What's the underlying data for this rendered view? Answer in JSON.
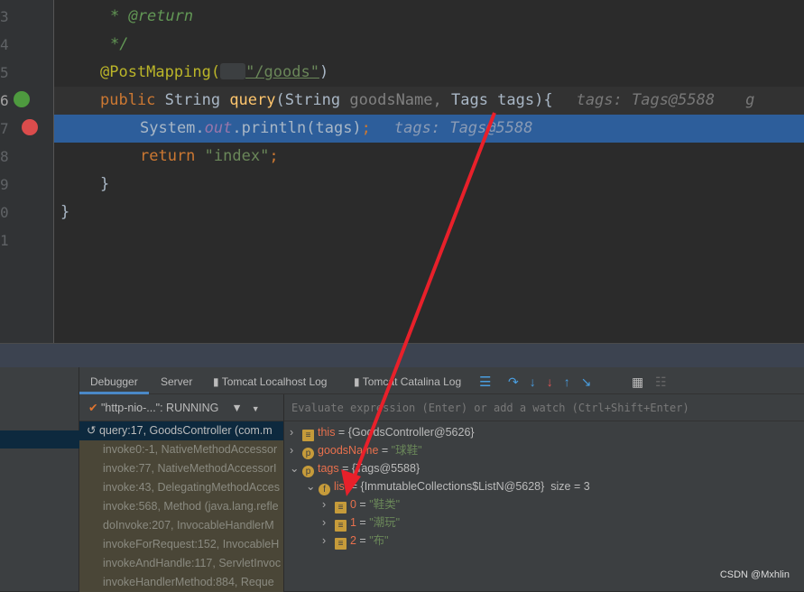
{
  "editor": {
    "line_numbers": [
      "3",
      "4",
      "5",
      "6",
      "7",
      "8",
      "9",
      "0",
      "1"
    ],
    "lines": {
      "l3": "* @return",
      "l4": "*/",
      "l5_ann": "@PostMapping(",
      "l5_str": "\"/goods\"",
      "l5_end": ")",
      "l6_kw": "public",
      "l6_type": " String ",
      "l6_fn": "query",
      "l6_a": "(String ",
      "l6_p": "goodsName,",
      "l6_b": " Tags tags){",
      "l6_hint": "tags: Tags@5588",
      "l6_hint2": "g",
      "l7_a": "System.",
      "l7_f": "out",
      "l7_b": ".println(tags)",
      "l7_semi": ";",
      "l7_hint": "tags: Tags@5588",
      "l8_kw": "return ",
      "l8_str": "\"index\"",
      "l8_end": ";",
      "l9": "}",
      "l10": "}"
    }
  },
  "debugger": {
    "tabs": [
      "Debugger",
      "Server",
      "Tomcat Localhost Log",
      "Tomcat Catalina Log"
    ],
    "thread": "\"http-nio-...\": RUNNING",
    "frames": [
      "query:17, GoodsController (com.m",
      "invoke0:-1, NativeMethodAccessor",
      "invoke:77, NativeMethodAccessorI",
      "invoke:43, DelegatingMethodAcces",
      "invoke:568, Method (java.lang.refle",
      "doInvoke:207, InvocableHandlerM",
      "invokeForRequest:152, InvocableH",
      "invokeAndHandle:117, ServletInvoc",
      "invokeHandlerMethod:884, Reque"
    ],
    "eval_placeholder": "Evaluate expression (Enter) or add a watch (Ctrl+Shift+Enter)",
    "vars": [
      {
        "name": "this",
        "value": "{GoodsController@5626}"
      },
      {
        "name": "goodsName",
        "value": "\"球鞋\""
      },
      {
        "name": "tags",
        "value": "{Tags@5588}"
      },
      {
        "name": "list",
        "value": "{ImmutableCollections$ListN@5628}",
        "extra": "size = 3"
      },
      {
        "name": "0",
        "value": "\"鞋类\""
      },
      {
        "name": "1",
        "value": "\"潮玩\""
      },
      {
        "name": "2",
        "value": "\"布\""
      }
    ]
  },
  "watermark": "CSDN @Mxhlin",
  "colors": {
    "highlight": "#2d5e9b",
    "arrow": "#e8202a",
    "accent": "#4a88c7"
  }
}
